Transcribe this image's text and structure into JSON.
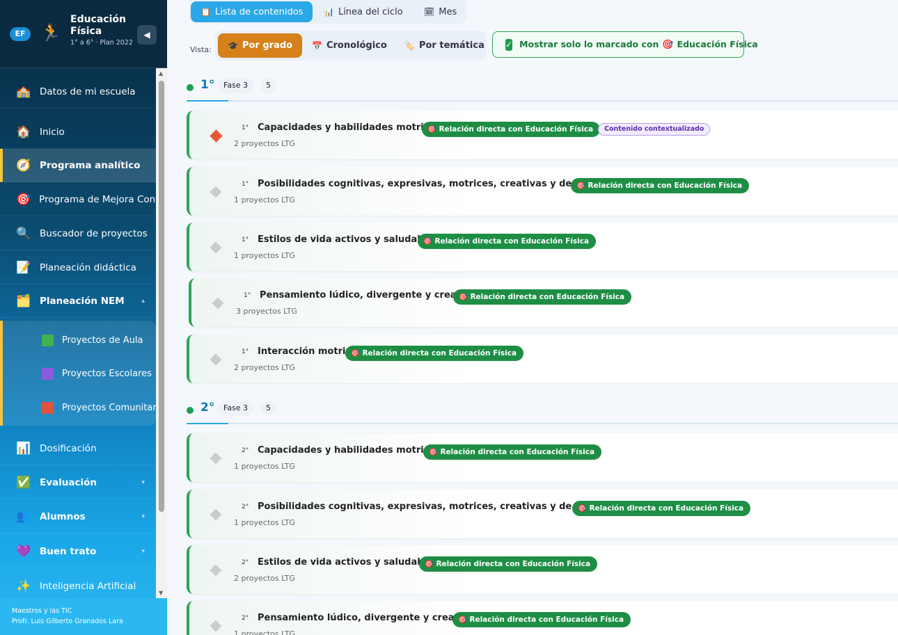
{
  "sidebar": {
    "badge": "EF",
    "runner_icon": "runner-icon",
    "title": "Educación Física",
    "subtitle": "1° a 6° · Plan 2022",
    "collapse_glyph": "◀",
    "items": [
      {
        "label": "Datos de mi escuela",
        "icon": "🏫"
      },
      {
        "label": "Inicio",
        "icon": "🏠"
      },
      {
        "label": "Programa analítico",
        "icon": "🧭"
      },
      {
        "label": "Programa de Mejora Continua",
        "icon": "🎯"
      },
      {
        "label": "Buscador de proyectos",
        "icon": "🔍"
      },
      {
        "label": "Planeación didáctica",
        "icon": "📝"
      },
      {
        "label": "Planeación NEM",
        "icon": "🗂️"
      },
      {
        "label": "Dosificación",
        "icon": "📊"
      },
      {
        "label": "Evaluación",
        "icon": "✅"
      },
      {
        "label": "Alumnos",
        "icon": "👥"
      },
      {
        "label": "Buen trato",
        "icon": "💜"
      },
      {
        "label": "Inteligencia Artificial",
        "icon": "✨"
      }
    ],
    "submenu": [
      {
        "label": "Proyectos de Aula",
        "color": "#3fb34f"
      },
      {
        "label": "Proyectos Escolares",
        "color": "#8e5be0"
      },
      {
        "label": "Proyectos Comunitarios",
        "color": "#e2533d"
      }
    ],
    "footer_line1": "Maestros y las TIC",
    "footer_line2": "Profr. Luis Gilberto Granados Lara"
  },
  "top_tabs": [
    {
      "label": "Lista de contenidos",
      "icon": "📋"
    },
    {
      "label": "Línea del ciclo",
      "icon": "📊"
    },
    {
      "label": "Mes",
      "icon": "🗓"
    }
  ],
  "view": {
    "label": "Vista:",
    "options": [
      {
        "label": "Por grado",
        "icon": "🎓"
      },
      {
        "label": "Cronológico",
        "icon": "📅"
      },
      {
        "label": "Por temática",
        "icon": "🏷️"
      }
    ],
    "filter": {
      "check": "✓",
      "text_before": "Mostrar solo lo marcado con",
      "target_icon": "🎯",
      "text_after": "Educación Física"
    }
  },
  "badge_text": "Relación directa con Educación Física",
  "badge_icon": "🎯",
  "ctx_badge_text": "Contenido contextualizado",
  "grades": [
    {
      "title": "1°",
      "fase": "Fase 3",
      "count": "5",
      "contents": [
        {
          "grade": "1°",
          "title": "Capacidades y habilidades motrices.",
          "projects": "2 proyectos LTG"
        },
        {
          "grade": "1°",
          "title": "Posibilidades cognitivas, expresivas, motrices, creativas y de relación.",
          "projects": "1 proyectos LTG"
        },
        {
          "grade": "1°",
          "title": "Estilos de vida activos y saludables.",
          "projects": "1 proyectos LTG"
        },
        {
          "grade": "1°",
          "title": "Pensamiento lúdico, divergente y creativo.",
          "projects": "3 proyectos LTG"
        },
        {
          "grade": "1°",
          "title": "Interacción motriz.",
          "projects": "2 proyectos LTG"
        }
      ]
    },
    {
      "title": "2°",
      "fase": "Fase 3",
      "count": "5",
      "contents": [
        {
          "grade": "2°",
          "title": "Capacidades y habilidades motrices.",
          "projects": "1 proyectos LTG"
        },
        {
          "grade": "2°",
          "title": "Posibilidades cognitivas, expresivas, motrices, creativas y de relación.",
          "projects": "1 proyectos LTG"
        },
        {
          "grade": "2°",
          "title": "Estilos de vida activos y saludables.",
          "projects": "2 proyectos LTG"
        },
        {
          "grade": "2°",
          "title": "Pensamiento lúdico, divergente y creativo.",
          "projects": "1 proyectos LTG"
        }
      ]
    }
  ]
}
